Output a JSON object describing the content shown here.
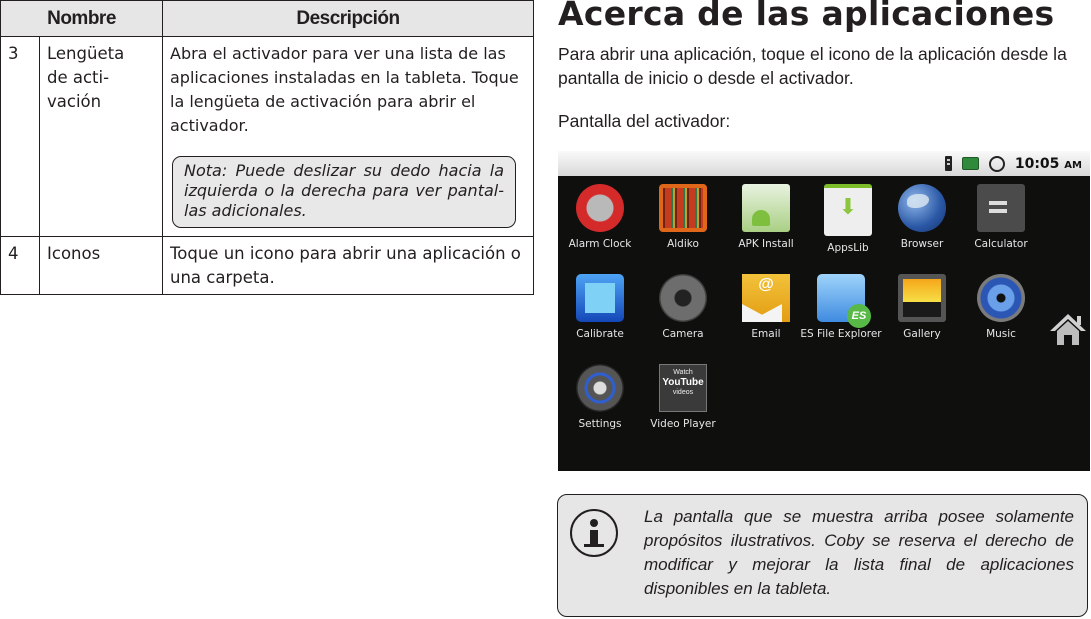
{
  "table": {
    "headers": [
      "Nombre",
      "Descripción"
    ],
    "rows": [
      {
        "num": "3",
        "name": "Lengüeta de acti-vación",
        "description": "Abra el activador para ver una lista de las aplicaciones instaladas en la tableta. Toque la lengüeta de activación para abrir el activador.",
        "note": "Nota: Puede deslizar su dedo hacia la izquierda o la derecha para ver pantal-las adicionales."
      },
      {
        "num": "4",
        "name": "Iconos",
        "description": "Toque un icono para abrir una aplicación o una carpeta."
      }
    ]
  },
  "section": {
    "title": "Acerca de las aplicaciones",
    "intro": "Para abrir una aplicación, toque el icono de la aplicación desde la pantalla de inicio o desde el activador.",
    "screen_caption": "Pantalla del activador:"
  },
  "launcher": {
    "status_bar": {
      "icons": [
        "sd-card-icon",
        "usb-icon",
        "alarm-icon"
      ],
      "time": "10:05",
      "ampm": "AM"
    },
    "apps": [
      {
        "label": "Alarm Clock",
        "icon": "alarm-clock-icon"
      },
      {
        "label": "Aldiko",
        "icon": "aldiko-icon"
      },
      {
        "label": "APK Install",
        "icon": "apk-install-icon"
      },
      {
        "label": "AppsLib",
        "icon": "appslib-icon"
      },
      {
        "label": "Browser",
        "icon": "browser-globe-icon"
      },
      {
        "label": "Calculator",
        "icon": "calculator-icon"
      },
      {
        "label": "Calibrate",
        "icon": "calibrate-icon"
      },
      {
        "label": "Camera",
        "icon": "camera-icon"
      },
      {
        "label": "Email",
        "icon": "email-icon"
      },
      {
        "label": "ES File Explorer",
        "icon": "es-file-explorer-icon"
      },
      {
        "label": "Gallery",
        "icon": "gallery-icon"
      },
      {
        "label": "Music",
        "icon": "music-speaker-icon"
      },
      {
        "label": "Settings",
        "icon": "settings-icon"
      },
      {
        "label": "Video Player",
        "icon": "youtube-video-icon"
      }
    ],
    "video_icon_text": {
      "top": "Watch",
      "mid": "YouTube",
      "bottom": "videos"
    }
  },
  "info_note": {
    "text": "La pantalla que se muestra arriba posee solamente propósitos ilustrativos. Coby se reserva el derecho de modificar y mejorar la lista final de aplicaciones disponibles en la tableta."
  }
}
